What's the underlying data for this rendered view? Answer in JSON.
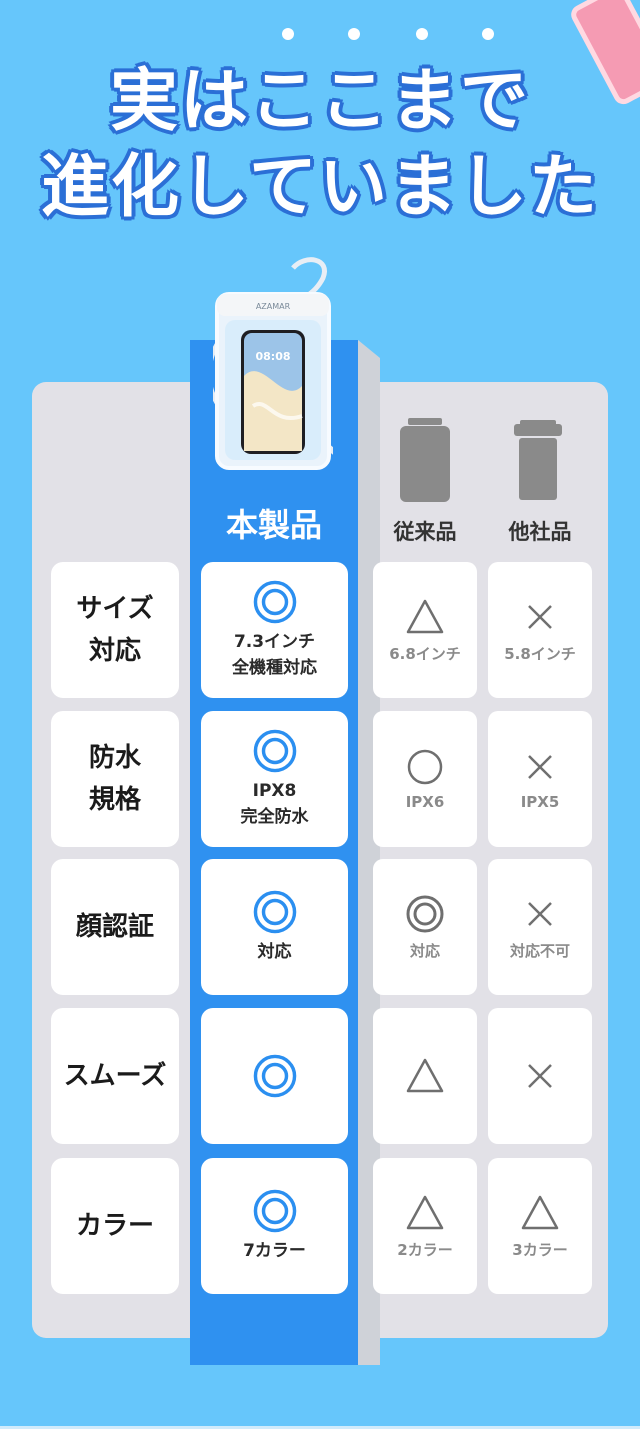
{
  "title": {
    "line1": "実はここまで",
    "line2": "進化していました"
  },
  "product": {
    "brand": "AZAMAR",
    "screen_time": "08:08"
  },
  "columns": {
    "main": "本製品",
    "conventional": "従来品",
    "others": "他社品"
  },
  "rows": [
    {
      "label": "サイズ\n対応",
      "main": {
        "symbol": "double-circle",
        "text": "7.3インチ\n全機種対応"
      },
      "conventional": {
        "symbol": "triangle",
        "text": "6.8インチ"
      },
      "others": {
        "symbol": "cross",
        "text": "5.8インチ"
      }
    },
    {
      "label": "防水\n規格",
      "main": {
        "symbol": "double-circle",
        "text": "IPX8\n完全防水"
      },
      "conventional": {
        "symbol": "circle",
        "text": "IPX6"
      },
      "others": {
        "symbol": "cross",
        "text": "IPX5"
      }
    },
    {
      "label": "顔認証",
      "main": {
        "symbol": "double-circle",
        "text": "対応"
      },
      "conventional": {
        "symbol": "double-circle",
        "text": "対応"
      },
      "others": {
        "symbol": "cross",
        "text": "対応不可"
      }
    },
    {
      "label": "スムーズ",
      "main": {
        "symbol": "double-circle",
        "text": ""
      },
      "conventional": {
        "symbol": "triangle",
        "text": ""
      },
      "others": {
        "symbol": "cross",
        "text": ""
      }
    },
    {
      "label": "カラー",
      "main": {
        "symbol": "double-circle",
        "text": "7カラー"
      },
      "conventional": {
        "symbol": "triangle",
        "text": "2カラー"
      },
      "others": {
        "symbol": "triangle",
        "text": "3カラー"
      }
    }
  ],
  "colors": {
    "background": "#66c6fb",
    "main_column": "#2f91f0",
    "main_symbol": "#2b8ff0",
    "sub_symbol": "#6f6f6f"
  }
}
